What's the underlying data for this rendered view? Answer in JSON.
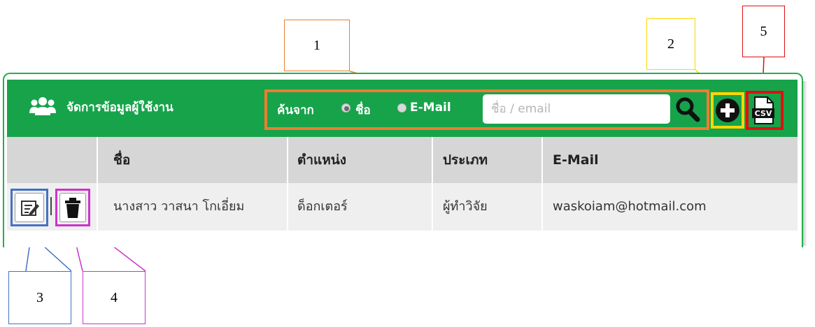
{
  "header": {
    "title": "จัดการข้อมูลผู้ใช้งาน"
  },
  "search": {
    "label": "ค้นจาก",
    "options": [
      {
        "label": "ชื่อ",
        "selected": true
      },
      {
        "label": "E-Mail",
        "selected": false
      }
    ],
    "placeholder": "ชื่อ / email"
  },
  "table": {
    "columns": [
      "ชื่อ",
      "ตำแหน่ง",
      "ประเภท",
      "E-Mail"
    ],
    "rows": [
      {
        "name": "นางสาว วาสนา โกเอี่ยม",
        "position": "ด็อกเตอร์",
        "type": "ผู้ทำวิจัย",
        "email": "waskoiam@hotmail.com"
      }
    ]
  },
  "annotations": {
    "search_group": "1",
    "add_button": "2",
    "edit_button": "3",
    "delete_button": "4",
    "csv_button": "5"
  },
  "icons": {
    "users": "users-icon",
    "search": "magnifier-icon",
    "add": "plus-circle-icon",
    "csv": "csv-file-icon",
    "edit": "edit-icon",
    "delete": "trash-icon"
  },
  "colors": {
    "header_green": "#17a34a",
    "callout1_orange": "#ed7d31",
    "callout2_yellow": "#ffd700",
    "callout3_blue": "#4472c4",
    "callout4_magenta": "#cc33cc",
    "callout5_red": "#e01010"
  }
}
